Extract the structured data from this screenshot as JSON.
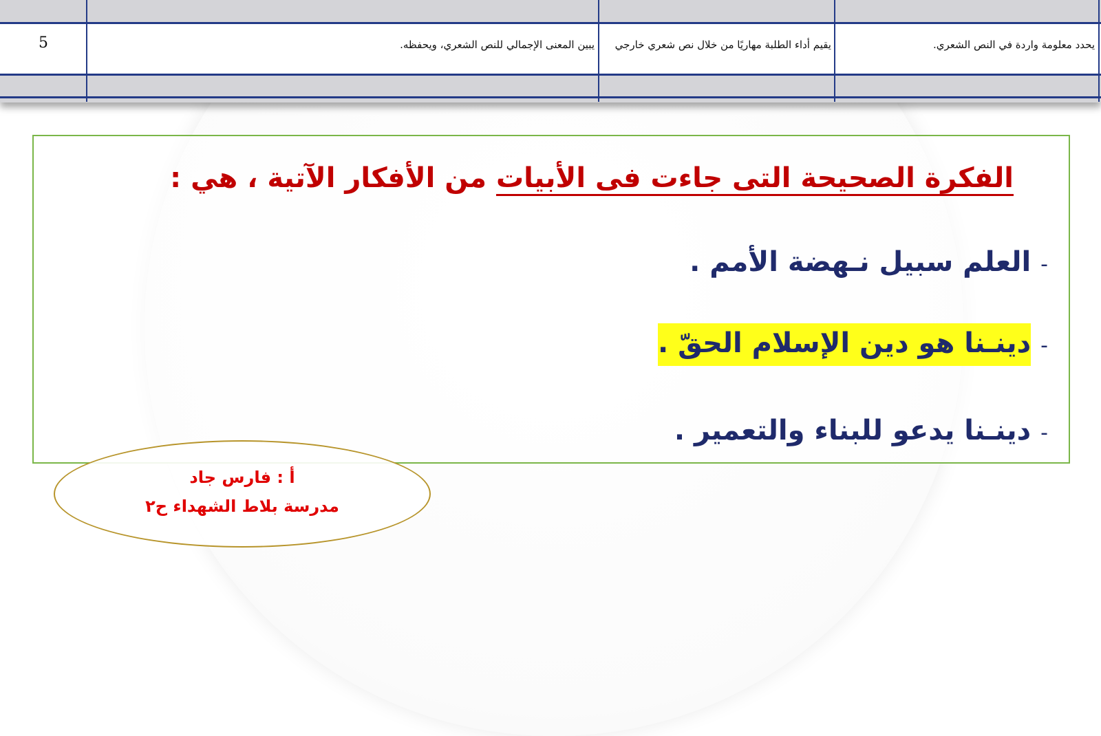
{
  "table": {
    "row": {
      "cell_objective": "يحدد معلومة واردة في النص الشعري.",
      "cell_evaluation": "يقيم أداء الطلبة مهاريًا من خلال نص شعري خارجي",
      "cell_outcome": "يبين المعنى الإجمالي للنص الشعري، ويحفظه.",
      "cell_number": "5"
    }
  },
  "question": {
    "title_underlined": "الفكرة الصحيحة التى جاءت فى الأبيات",
    "title_rest": " من الأفكار الآتية ، هي :",
    "options": [
      {
        "dash": "-",
        "text": "العلم سبيل نـهضة الأمم ."
      },
      {
        "dash": "-",
        "text": "دينـنا هو دين الإسلام الحقّ ."
      },
      {
        "dash": "-",
        "text": "دينـنا يدعو للبناء والتعمير ."
      }
    ],
    "highlight_color": "#ffff1a",
    "title_color": "#c00000",
    "option_color": "#1f2a6b"
  },
  "teacher": {
    "name_line": "أ : فارس جاد",
    "school_line": "مدرسة بلاط الشهداء ح٢"
  }
}
